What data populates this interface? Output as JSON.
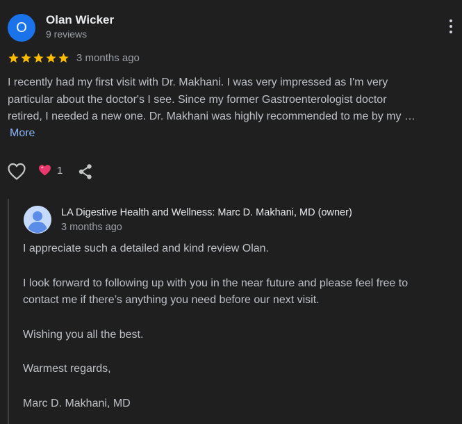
{
  "review": {
    "reviewer": {
      "initial": "O",
      "name": "Olan Wicker",
      "meta": "9 reviews",
      "avatar_color": "#1a73e8"
    },
    "rating": 5,
    "star_color": "#fbbc04",
    "date": "3 months ago",
    "text_lines": [
      "I recently had my first visit with Dr. Makhani. I was very impressed as I'm very",
      "particular about the doctor's I see. Since my former Gastroenterologist doctor",
      "retired, I needed a new one. Dr. Makhani was highly recommended to me by my …"
    ],
    "more_label": "More",
    "actions": {
      "like_icon": "heart-outline-icon",
      "reaction_icon": "heart-emoji-icon",
      "reaction_count": "1",
      "share_icon": "share-icon"
    }
  },
  "owner_response": {
    "name": "LA Digestive Health and Wellness: Marc D. Makhani, MD (owner)",
    "date": "3 months ago",
    "paragraphs": {
      "p1": [
        "I appreciate such a detailed and kind review Olan."
      ],
      "p2": [
        "I look forward to following up with you in the near future and please feel free to",
        "contact me if there’s anything you need before our next visit."
      ],
      "p3": [
        "Wishing you all the best."
      ],
      "p4": [
        "Warmest regards,"
      ],
      "p5": [
        "Marc D. Makhani, MD"
      ]
    }
  },
  "colors": {
    "background": "#1f1f1f",
    "link": "#8ab4f8",
    "reaction_heart": "#e8386e"
  }
}
